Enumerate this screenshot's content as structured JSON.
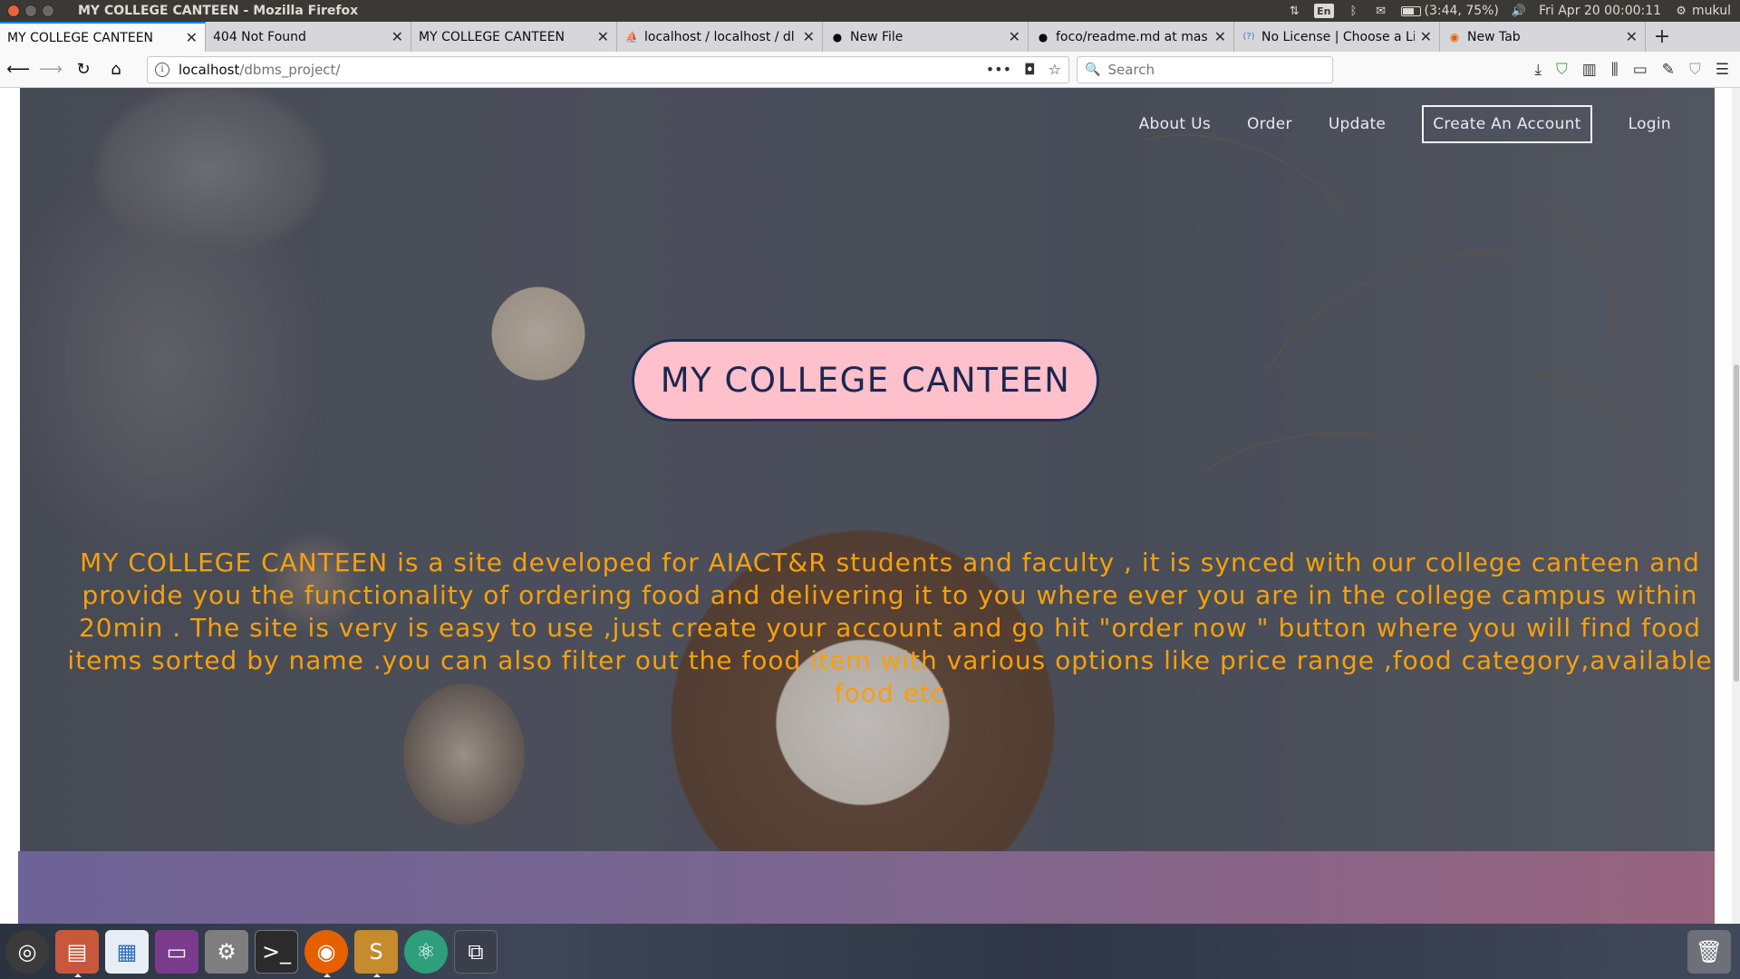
{
  "window": {
    "title": "MY COLLEGE CANTEEN - Mozilla Firefox"
  },
  "panel": {
    "language": "En",
    "battery_text": "(3:44, 75%)",
    "battery_level": 0.75,
    "datetime": "Fri Apr 20 00:00:11",
    "user": "mukul"
  },
  "tabs": [
    {
      "label": "MY COLLEGE CANTEEN",
      "icon": "none",
      "active": true
    },
    {
      "label": "404 Not Found",
      "icon": "none",
      "active": false
    },
    {
      "label": "MY COLLEGE CANTEEN",
      "icon": "none",
      "active": false
    },
    {
      "label": "localhost / localhost / dl",
      "icon": "phpmyadmin-icon",
      "active": false
    },
    {
      "label": "New File",
      "icon": "github-icon",
      "active": false
    },
    {
      "label": "foco/readme.md at mas",
      "icon": "github-icon",
      "active": false
    },
    {
      "label": "No License | Choose a Li",
      "icon": "choosealicense-icon",
      "active": false
    },
    {
      "label": "New Tab",
      "icon": "firefox-icon",
      "active": false
    }
  ],
  "urlbar": {
    "host": "localhost",
    "path": "/dbms_project/"
  },
  "searchbar": {
    "placeholder": "Search"
  },
  "site": {
    "nav": {
      "about": "About Us",
      "order": "Order",
      "update": "Update",
      "create_account": "Create An Account",
      "login": "Login"
    },
    "brand": "MY COLLEGE CANTEEN",
    "intro": "MY COLLEGE CANTEEN is a site developed for AIACT&R students and faculty , it is synced with our college canteen and provide you the functionality of ordering food and delivering it to you where ever you are in the college campus within 20min . The site is very is easy to use ,just create your account and go hit \"order now \" button where you will find food items sorted by name .you can also filter out the food item with various options like price range ,food category,available food etc",
    "colors": {
      "pill_bg": "#fec0cb",
      "pill_text": "#1c2750",
      "intro_text": "#f5a00f"
    }
  },
  "dock": [
    {
      "name": "ubuntu-dash-icon"
    },
    {
      "name": "files-icon",
      "running": true
    },
    {
      "name": "libreoffice-writer-icon"
    },
    {
      "name": "app-launcher-icon"
    },
    {
      "name": "system-settings-icon"
    },
    {
      "name": "terminal-icon"
    },
    {
      "name": "firefox-icon",
      "running": true
    },
    {
      "name": "sublime-text-icon",
      "running": true
    },
    {
      "name": "atom-icon"
    },
    {
      "name": "workspace-switcher-icon"
    }
  ]
}
